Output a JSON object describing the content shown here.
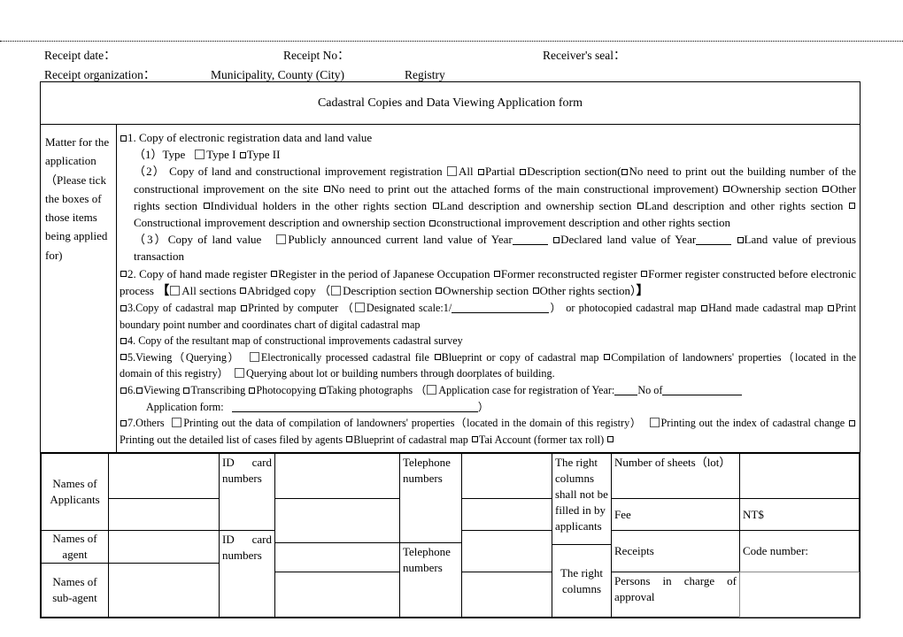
{
  "header": {
    "receipt_date_label": "Receipt date：",
    "receipt_no_label": "Receipt No：",
    "receivers_seal_label": "Receiver's seal：",
    "receipt_org_label": "Receipt organization：",
    "municipality_label": "Municipality, County (City)",
    "registry_label": "Registry"
  },
  "form": {
    "title": "Cadastral Copies and Data Viewing Application form",
    "matter_label": "Matter for the application（Please tick the boxes of those items being applied for)"
  },
  "items": {
    "i1": "1. Copy of electronic registration data and land value",
    "i1_1_head": "（1）Type",
    "i1_1_a": "Type I",
    "i1_1_b": "Type II",
    "i1_2_head": "（2）  Copy  of  land  and  constructional  improvement  registration",
    "i1_2_all": "All",
    "i1_2_partial": "Partial",
    "i1_2_desc": "Description section(",
    "i1_2_noprint1": "No need to print out the building number of the constructional improvement on the site",
    "i1_2_noprint2": "No need to print out the attached forms of the main constructional improvement)",
    "i1_2_own": "Ownership section",
    "i1_2_other": "Other rights section",
    "i1_2_indiv": "Individual holders in the other rights section",
    "i1_2_landdesc": "Land  description and ownership section",
    "i1_2_landother": "Land description and other rights section",
    "i1_2_cidesc": "Constructional improvement description and ownership section",
    "i1_2_ciother": "constructional improvement description and other rights section",
    "i1_3_head": "（3）Copy of land value",
    "i1_3_pub": "Publicly announced current land value of Year",
    "i1_3_dec": "Declared land value of Year",
    "i1_3_prev": "Land value of previous transaction",
    "i2_a": "2. Copy of hand made register",
    "i2_b": "Register in the period of Japanese Occupation",
    "i2_c": "Former reconstructed register",
    "i2_d": "Former register constructed before electronic process",
    "i2_e": "All sections",
    "i2_f": "Abridged copy",
    "i2_g": "Description section",
    "i2_h": "Ownership section",
    "i2_i": "Other rights section",
    "i3_a": "3.Copy of cadastral map",
    "i3_b": "Printed by computer",
    "i3_c": "Designated scale:1/",
    "i3_d": "or photocopied cadastral map",
    "i3_e": "Hand made cadastral map",
    "i3_f": "Print boundary point number and coordinates chart of digital cadastral map",
    "i4": "4. Copy of the resultant map of constructional improvements cadastral survey",
    "i5_a": "5.Viewing（Querying）",
    "i5_b": "Electronically processed cadastral file",
    "i5_c": "Blueprint or copy of cadastral map",
    "i5_d": "Compilation of landowners' properties（located in the domain of this registry）",
    "i5_e": "Querying about lot or building numbers through doorplates of building.",
    "i6_a": "6.",
    "i6_b": "Viewing",
    "i6_c": "Transcribing",
    "i6_d": "Photocopying",
    "i6_e": "Taking photographs",
    "i6_f": "Application case for registration of Year:",
    "i6_g": "No of",
    "i6_h": "Application form:",
    "i7_a": "7.Others",
    "i7_b": "Printing out the data of compilation of landowners' properties（located in the domain of this registry）",
    "i7_c": "Printing out the index of cadastral change",
    "i7_d": "Printing out the detailed list of cases filed by agents",
    "i7_e": "Blueprint of cadastral map",
    "i7_f": "Tai Account (former tax roll)"
  },
  "bottom": {
    "names_applicants": "Names of Applicants",
    "names_agent": "Names of agent",
    "names_subagent": "Names of sub-agent",
    "id_card_numbers_1": "ID card numbers",
    "id_card_numbers_2": "ID card numbers",
    "telephone_numbers_1": "Telephone numbers",
    "telephone_numbers_2": "Telephone numbers",
    "right_columns_note": "The right columns shall not be filled in by applicants",
    "right_columns_note2": "The right columns",
    "number_of_sheets": "Number of sheets（lot）",
    "fee": "Fee",
    "nt_dollar": "NT$",
    "receipts": "Receipts",
    "code_number": "Code number:",
    "persons_in_charge": "Persons in charge of approval"
  }
}
